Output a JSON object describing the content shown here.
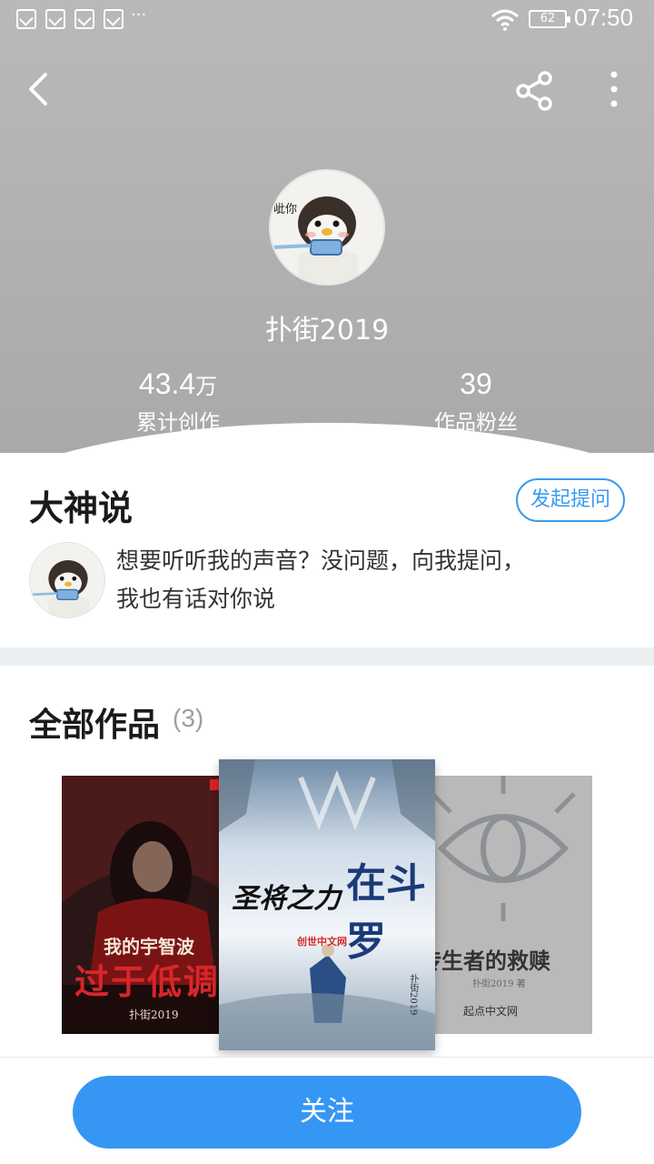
{
  "status_bar": {
    "dots": "···",
    "battery": "62",
    "time": "07:50"
  },
  "nav": {
    "back_icon": "chevron-left-icon",
    "share_icon": "share-icon",
    "more_icon": "more-vertical-icon"
  },
  "profile": {
    "name": "扑街2019",
    "avatar_text": "呲你",
    "stats": [
      {
        "number": "43.4",
        "unit": "万",
        "label": "累计创作"
      },
      {
        "number": "39",
        "unit": "",
        "label": "作品粉丝"
      }
    ]
  },
  "dashen": {
    "title": "大神说",
    "ask_button": "发起提问",
    "message_line1": "想要听听我的声音？没问题，向我提问，",
    "message_line2": "我也有话对你说"
  },
  "works": {
    "title": "全部作品",
    "count": "(3)",
    "books": [
      {
        "title_line1": "我的宇智波",
        "title_line2": "过于低调",
        "author": "扑街2019"
      },
      {
        "title_line1": "圣将之力",
        "title_line2": "在斗罗",
        "badge": "创世中文网",
        "author": "扑街2019"
      },
      {
        "title_line1": "传生者的救赎",
        "author": "扑街2019 著",
        "badge": "起点中文网"
      }
    ]
  },
  "follow_button": "关注",
  "colors": {
    "accent": "#3696f4",
    "ask_border": "#3a9bef",
    "header_bg": "#b3b3b3"
  }
}
